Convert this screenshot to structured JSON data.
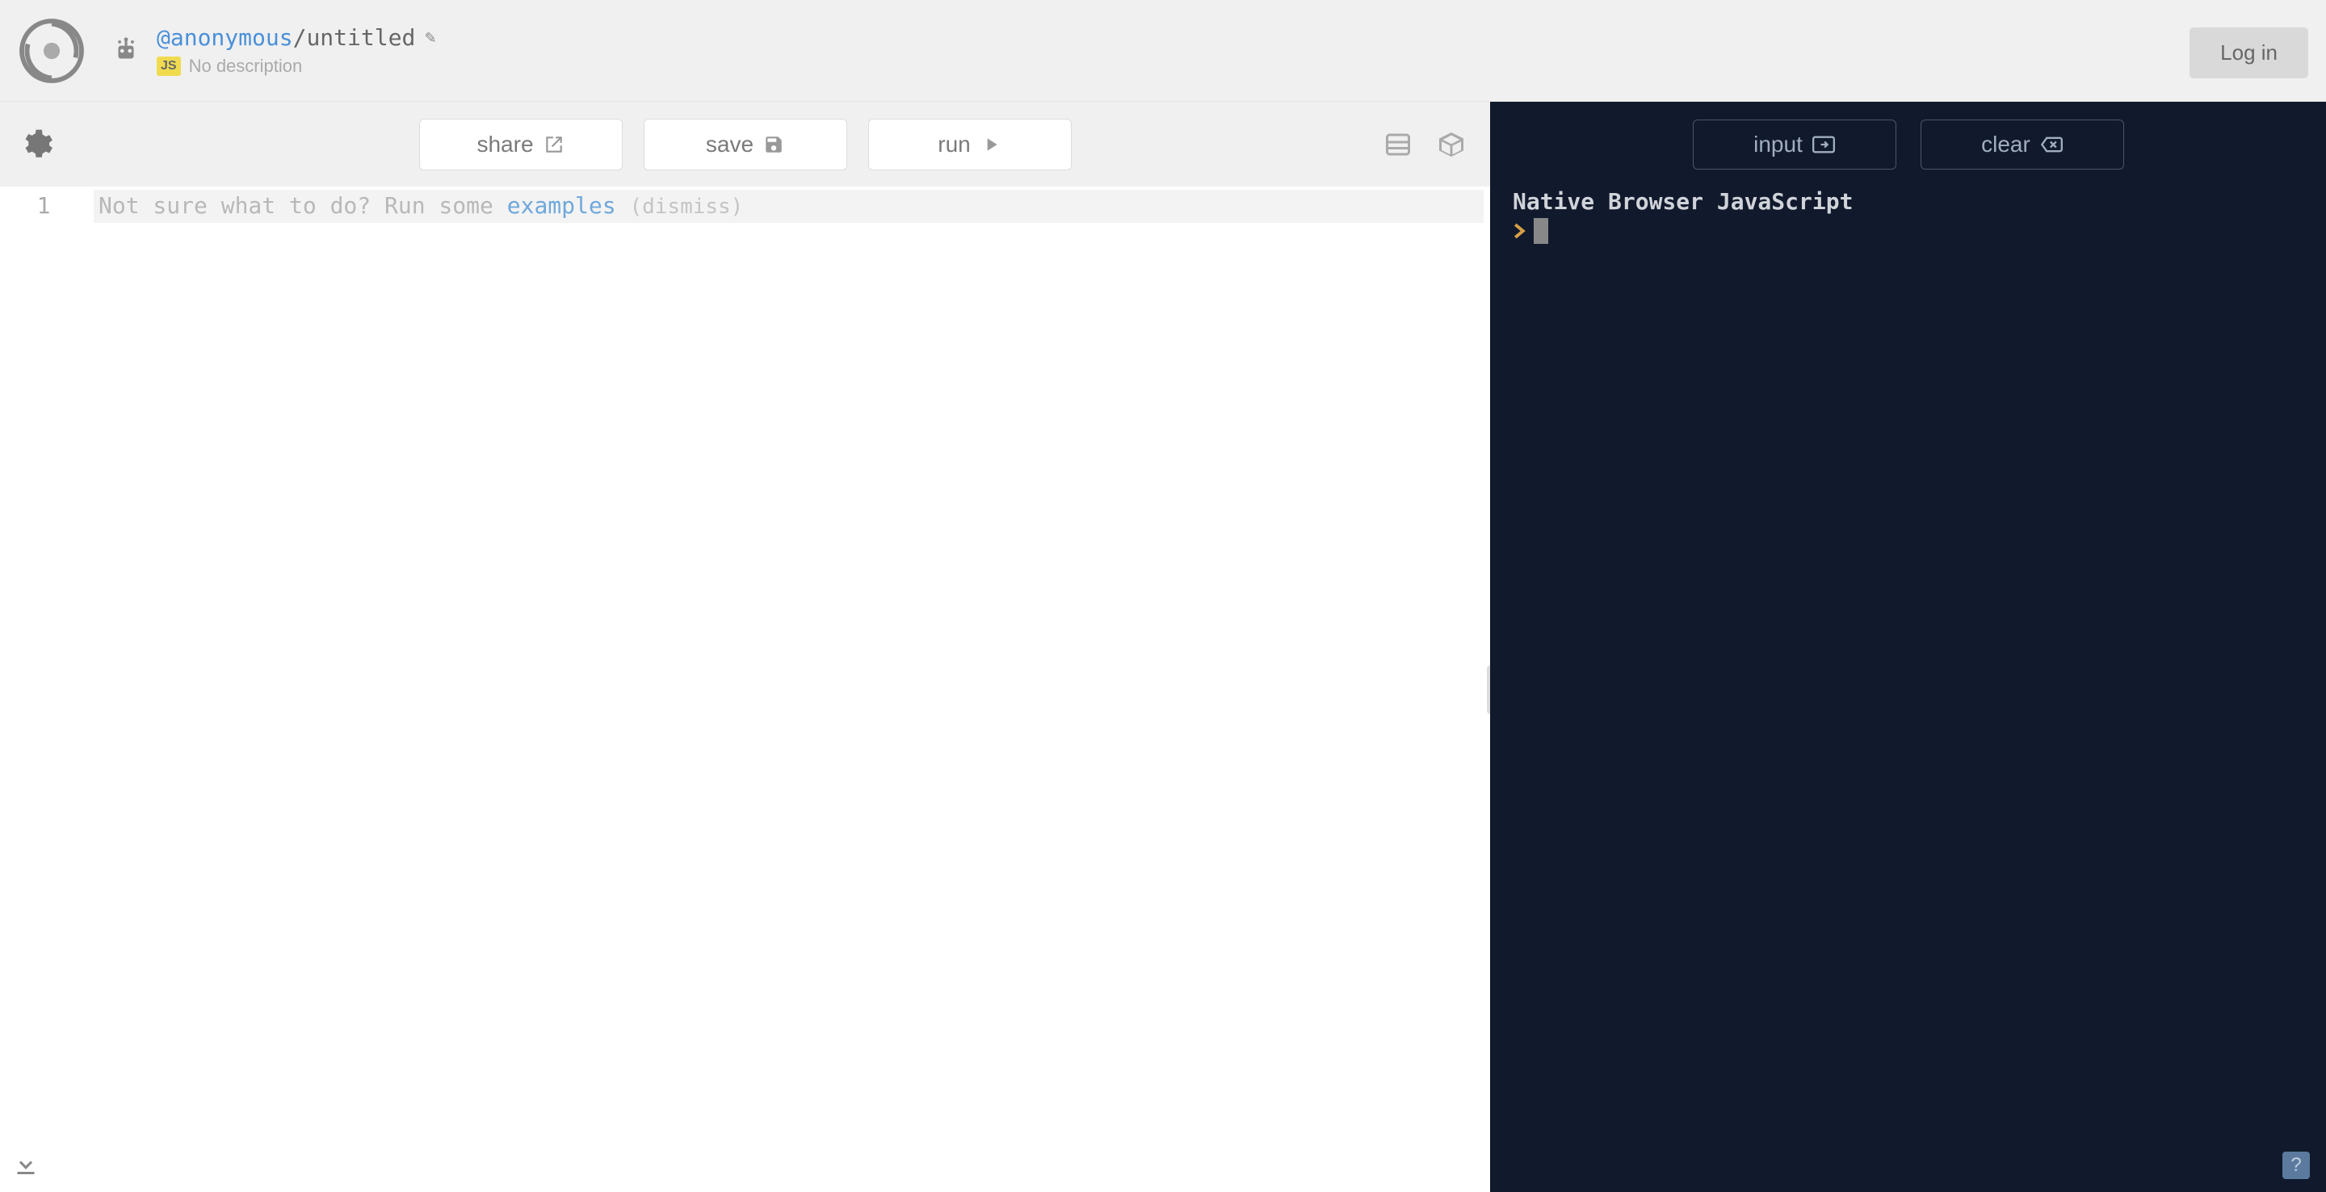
{
  "header": {
    "owner": "@anonymous",
    "slash": "/",
    "title": "untitled",
    "js_badge": "JS",
    "description": "No description",
    "login_label": "Log in"
  },
  "toolbar": {
    "share_label": "share",
    "save_label": "save",
    "run_label": "run"
  },
  "editor": {
    "line_number": "1",
    "hint_text": "Not sure what to do? Run some ",
    "hint_examples": "examples",
    "hint_dismiss": "(dismiss)"
  },
  "console": {
    "input_label": "input",
    "clear_label": "clear",
    "banner": "Native Browser JavaScript"
  }
}
